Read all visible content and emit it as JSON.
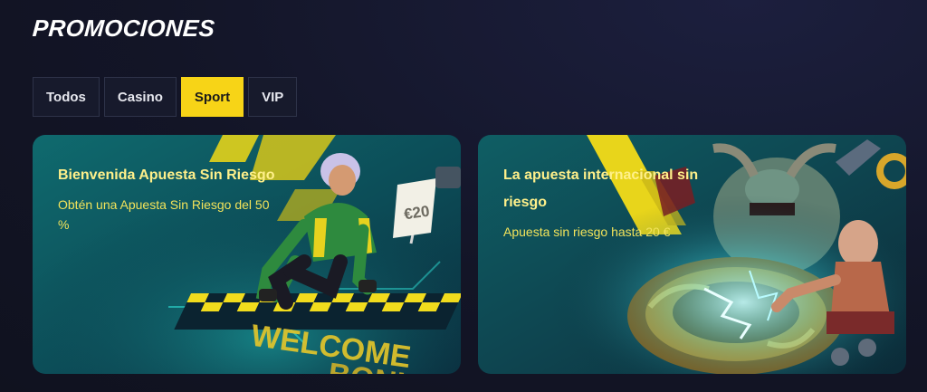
{
  "page": {
    "title": "PROMOCIONES"
  },
  "tabs": [
    {
      "label": "Todos",
      "active": false
    },
    {
      "label": "Casino",
      "active": false
    },
    {
      "label": "Sport",
      "active": true
    },
    {
      "label": "VIP",
      "active": false
    }
  ],
  "promos": [
    {
      "title": "Bienvenida Apuesta Sin Riesgo",
      "description": "Obtén una Apuesta Sin Riesgo del 50 %",
      "art": {
        "banner_text": "WELCOME BONUS",
        "flag_text": "€20"
      }
    },
    {
      "title": "La apuesta internacional sin riesgo",
      "description": "Apuesta sin riesgo hasta 20 €"
    }
  ],
  "colors": {
    "accent": "#f7d417",
    "background": "#131527",
    "card_teal": "#0d4d55",
    "promo_text": "#f2e35a"
  }
}
